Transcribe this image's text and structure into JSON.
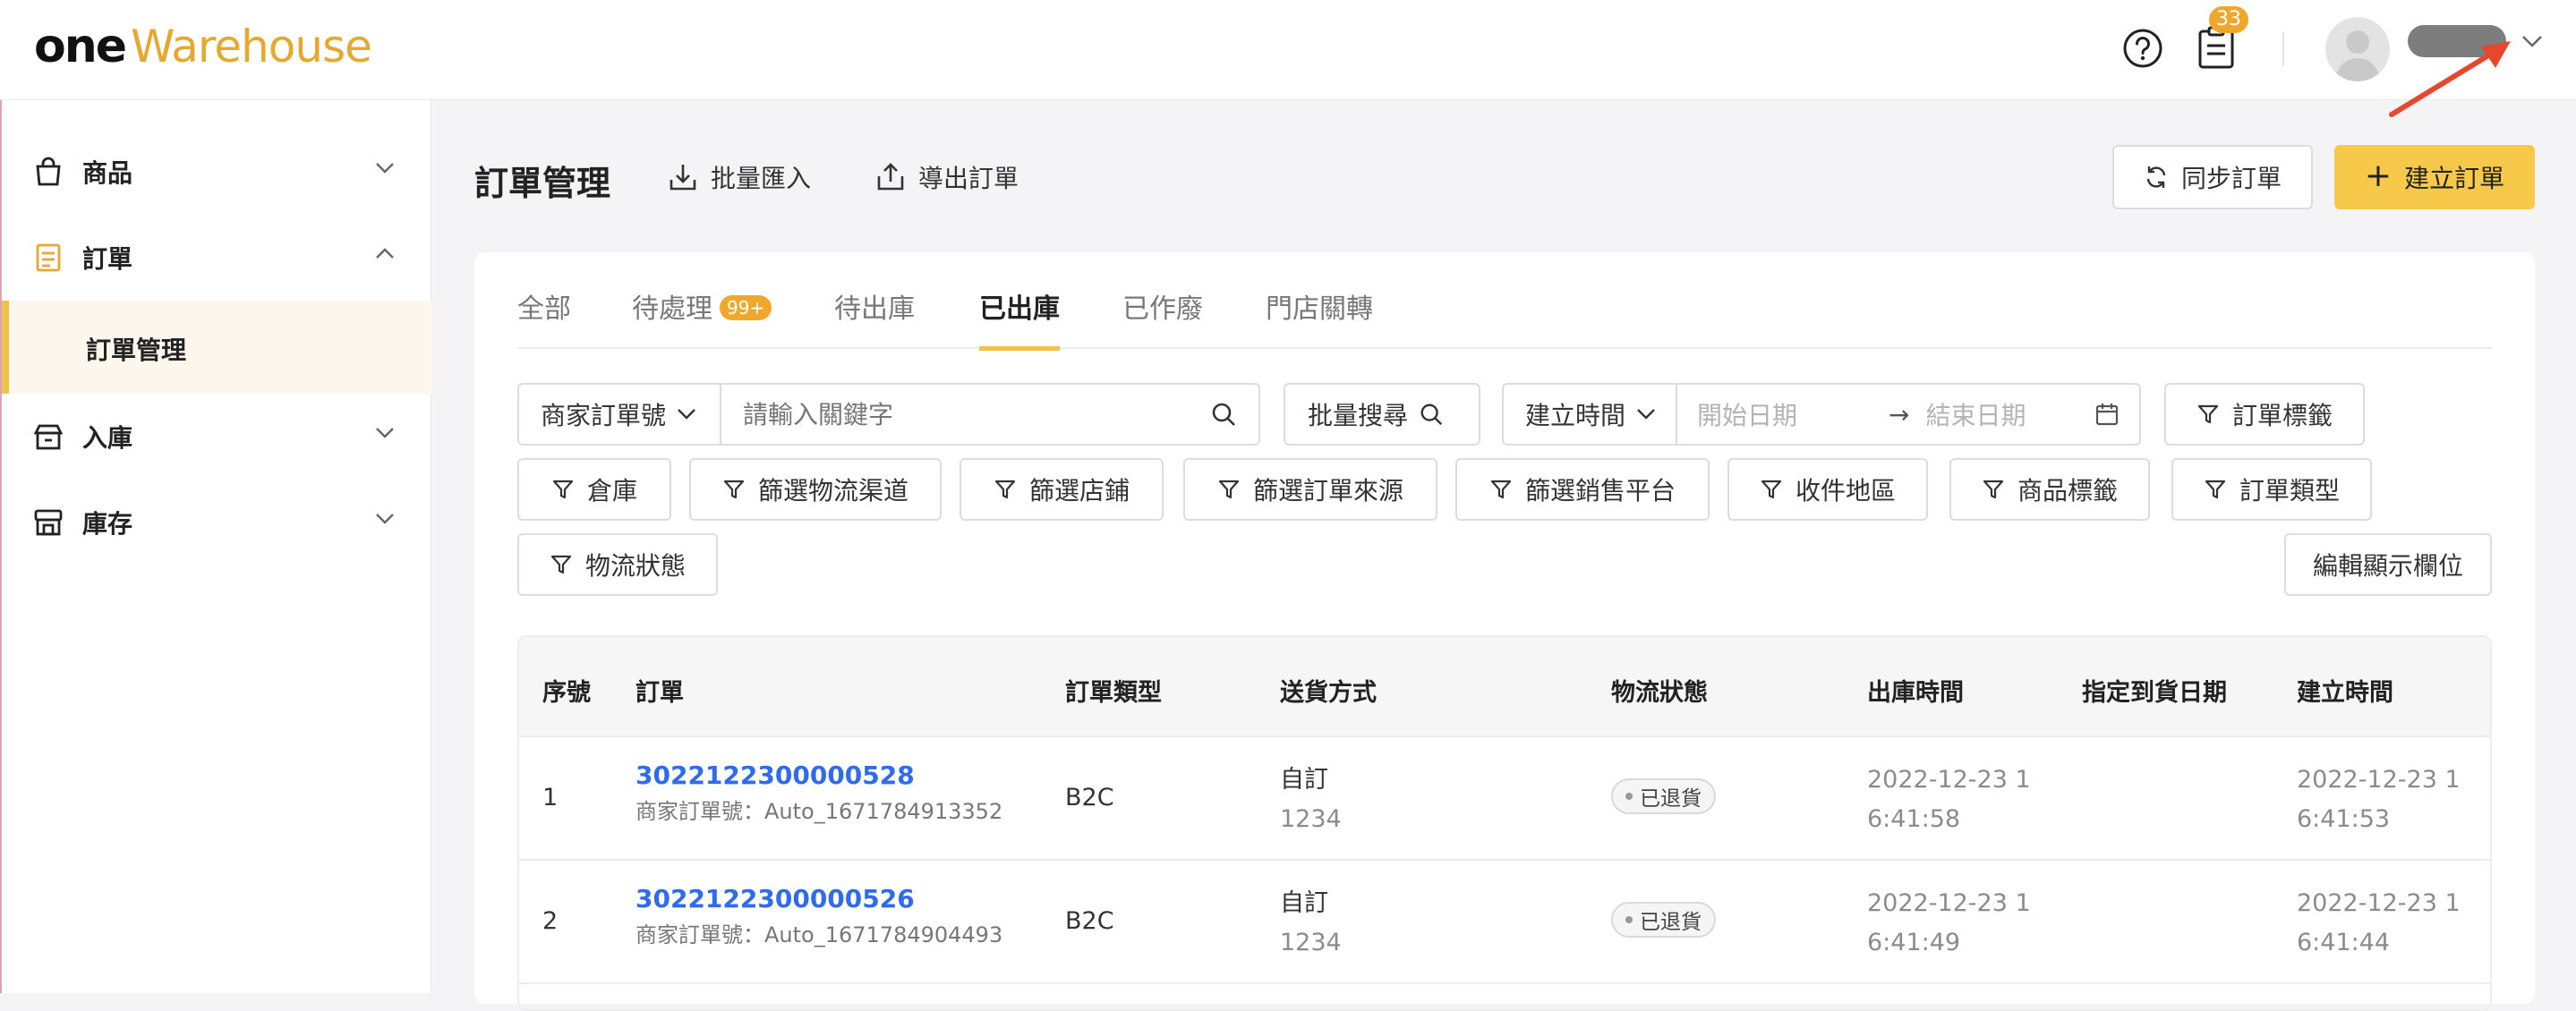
{
  "brand": {
    "part1": "one",
    "part2": "Warehouse"
  },
  "header": {
    "notification_count": "33"
  },
  "sidebar": {
    "items": [
      {
        "label": "商品"
      },
      {
        "label": "訂單"
      },
      {
        "label": "訂單管理"
      },
      {
        "label": "入庫"
      },
      {
        "label": "庫存"
      }
    ]
  },
  "page": {
    "title": "訂單管理",
    "import_label": "批量匯入",
    "export_label": "導出訂單",
    "sync_label": "同步訂單",
    "create_label": "建立訂單"
  },
  "tabs": [
    {
      "label": "全部"
    },
    {
      "label": "待處理",
      "badge": "99+"
    },
    {
      "label": "待出庫"
    },
    {
      "label": "已出庫"
    },
    {
      "label": "已作廢"
    },
    {
      "label": "門店關轉"
    }
  ],
  "filters": {
    "search_field_select": "商家訂單號",
    "search_placeholder": "請輸入關鍵字",
    "batch_search": "批量搜尋",
    "time_select": "建立時間",
    "start_date_placeholder": "開始日期",
    "end_date_placeholder": "結束日期",
    "buttons": [
      "訂單標籤",
      "倉庫",
      "篩選物流渠道",
      "篩選店鋪",
      "篩選訂單來源",
      "篩選銷售平台",
      "收件地區",
      "商品標籤",
      "訂單類型",
      "物流狀態"
    ],
    "edit_columns": "編輯顯示欄位"
  },
  "table": {
    "columns": [
      "序號",
      "訂單",
      "訂單類型",
      "送貨方式",
      "物流狀態",
      "出庫時間",
      "指定到貨日期",
      "建立時間"
    ],
    "rows": [
      {
        "index": "1",
        "order_no": "3022122300000528",
        "merchant_no": "商家訂單號：Auto_1671784913352",
        "type": "B2C",
        "delivery": "自訂",
        "delivery_sub": "1234",
        "status": "已退貨",
        "outbound_1": "2022-12-23 1",
        "outbound_2": "6:41:58",
        "arrival": "",
        "created_1": "2022-12-23 1",
        "created_2": "6:41:53"
      },
      {
        "index": "2",
        "order_no": "3022122300000526",
        "merchant_no": "商家訂單號：Auto_1671784904493",
        "type": "B2C",
        "delivery": "自訂",
        "delivery_sub": "1234",
        "status": "已退貨",
        "outbound_1": "2022-12-23 1",
        "outbound_2": "6:41:49",
        "arrival": "",
        "created_1": "2022-12-23 1",
        "created_2": "6:41:44"
      }
    ]
  }
}
